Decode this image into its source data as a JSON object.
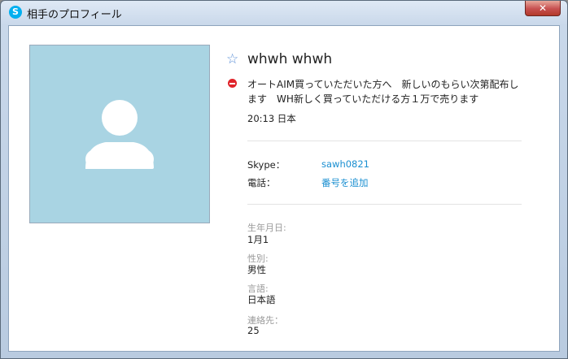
{
  "window": {
    "title": "相手のプロフィール",
    "app_icon_letter": "S",
    "close_glyph": "✕"
  },
  "profile": {
    "display_name": "whwh whwh",
    "mood_message": "オートAIM買っていただいた方へ　新しいのもらい次第配布します　WH新しく買っていただける方１万で売ります",
    "local_time": "20:13 日本",
    "status_color": "#e0242a",
    "avatar_color": "#a9d4e3"
  },
  "contact": {
    "skype_label": "Skype：",
    "skype_value": "sawh0821",
    "phone_label": "電話：",
    "phone_action": "番号を追加"
  },
  "details": [
    {
      "label": "生年月日:",
      "value": "1月1"
    },
    {
      "label": "性別:",
      "value": "男性"
    },
    {
      "label": "言語:",
      "value": "日本語"
    },
    {
      "label": "連絡先：",
      "value": "25"
    }
  ],
  "icons": {
    "favorite": "star-outline-icon",
    "status": "do-not-disturb-icon",
    "avatar": "default-user-silhouette-icon"
  }
}
